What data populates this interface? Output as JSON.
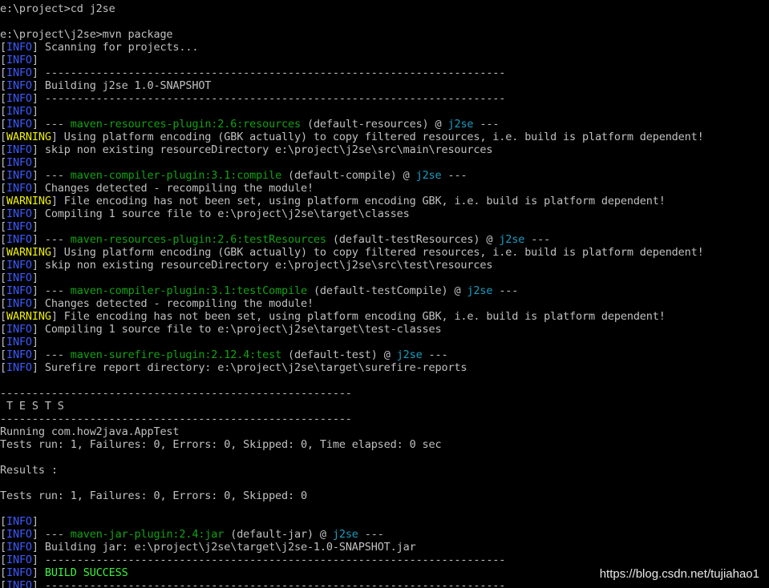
{
  "colors": {
    "background": "#000000",
    "text": "#c0c0c0",
    "info_tag": "#3b5bff",
    "plugin_name": "#12a312",
    "project_name": "#1a9ec2",
    "warning_tag": "#f0f000",
    "success": "#3cf23c"
  },
  "lines": [
    {
      "segs": [
        {
          "t": "e:\\project>cd j2se",
          "c": "default"
        }
      ]
    },
    {
      "segs": [
        {
          "t": "",
          "c": "default"
        }
      ]
    },
    {
      "segs": [
        {
          "t": "e:\\project\\j2se>mvn package",
          "c": "default"
        }
      ]
    },
    {
      "segs": [
        {
          "t": "[",
          "c": "default"
        },
        {
          "t": "INFO",
          "c": "blue"
        },
        {
          "t": "] Scanning for projects...",
          "c": "default"
        }
      ]
    },
    {
      "segs": [
        {
          "t": "[",
          "c": "default"
        },
        {
          "t": "INFO",
          "c": "blue"
        },
        {
          "t": "]",
          "c": "default"
        }
      ]
    },
    {
      "segs": [
        {
          "t": "[",
          "c": "default"
        },
        {
          "t": "INFO",
          "c": "blue"
        },
        {
          "t": "] ------------------------------------------------------------------------",
          "c": "default"
        }
      ]
    },
    {
      "segs": [
        {
          "t": "[",
          "c": "default"
        },
        {
          "t": "INFO",
          "c": "blue"
        },
        {
          "t": "] Building j2se 1.0-SNAPSHOT",
          "c": "default"
        }
      ]
    },
    {
      "segs": [
        {
          "t": "[",
          "c": "default"
        },
        {
          "t": "INFO",
          "c": "blue"
        },
        {
          "t": "] ------------------------------------------------------------------------",
          "c": "default"
        }
      ]
    },
    {
      "segs": [
        {
          "t": "[",
          "c": "default"
        },
        {
          "t": "INFO",
          "c": "blue"
        },
        {
          "t": "]",
          "c": "default"
        }
      ]
    },
    {
      "segs": [
        {
          "t": "[",
          "c": "default"
        },
        {
          "t": "INFO",
          "c": "blue"
        },
        {
          "t": "] --- ",
          "c": "default"
        },
        {
          "t": "maven-resources-plugin:2.6:resources",
          "c": "green"
        },
        {
          "t": " (default-resources) @ ",
          "c": "default"
        },
        {
          "t": "j2se",
          "c": "cyan"
        },
        {
          "t": " ---",
          "c": "default"
        }
      ]
    },
    {
      "segs": [
        {
          "t": "[",
          "c": "default"
        },
        {
          "t": "WARNING",
          "c": "yellow"
        },
        {
          "t": "] Using platform encoding (GBK actually) to copy filtered resources, i.e. build is platform dependent!",
          "c": "default"
        }
      ]
    },
    {
      "segs": [
        {
          "t": "[",
          "c": "default"
        },
        {
          "t": "INFO",
          "c": "blue"
        },
        {
          "t": "] skip non existing resourceDirectory e:\\project\\j2se\\src\\main\\resources",
          "c": "default"
        }
      ]
    },
    {
      "segs": [
        {
          "t": "[",
          "c": "default"
        },
        {
          "t": "INFO",
          "c": "blue"
        },
        {
          "t": "]",
          "c": "default"
        }
      ]
    },
    {
      "segs": [
        {
          "t": "[",
          "c": "default"
        },
        {
          "t": "INFO",
          "c": "blue"
        },
        {
          "t": "] --- ",
          "c": "default"
        },
        {
          "t": "maven-compiler-plugin:3.1:compile",
          "c": "green"
        },
        {
          "t": " (default-compile) @ ",
          "c": "default"
        },
        {
          "t": "j2se",
          "c": "cyan"
        },
        {
          "t": " ---",
          "c": "default"
        }
      ]
    },
    {
      "segs": [
        {
          "t": "[",
          "c": "default"
        },
        {
          "t": "INFO",
          "c": "blue"
        },
        {
          "t": "] Changes detected - recompiling the module!",
          "c": "default"
        }
      ]
    },
    {
      "segs": [
        {
          "t": "[",
          "c": "default"
        },
        {
          "t": "WARNING",
          "c": "yellow"
        },
        {
          "t": "] File encoding has not been set, using platform encoding GBK, i.e. build is platform dependent!",
          "c": "default"
        }
      ]
    },
    {
      "segs": [
        {
          "t": "[",
          "c": "default"
        },
        {
          "t": "INFO",
          "c": "blue"
        },
        {
          "t": "] Compiling 1 source file to e:\\project\\j2se\\target\\classes",
          "c": "default"
        }
      ]
    },
    {
      "segs": [
        {
          "t": "[",
          "c": "default"
        },
        {
          "t": "INFO",
          "c": "blue"
        },
        {
          "t": "]",
          "c": "default"
        }
      ]
    },
    {
      "segs": [
        {
          "t": "[",
          "c": "default"
        },
        {
          "t": "INFO",
          "c": "blue"
        },
        {
          "t": "] --- ",
          "c": "default"
        },
        {
          "t": "maven-resources-plugin:2.6:testResources",
          "c": "green"
        },
        {
          "t": " (default-testResources) @ ",
          "c": "default"
        },
        {
          "t": "j2se",
          "c": "cyan"
        },
        {
          "t": " ---",
          "c": "default"
        }
      ]
    },
    {
      "segs": [
        {
          "t": "[",
          "c": "default"
        },
        {
          "t": "WARNING",
          "c": "yellow"
        },
        {
          "t": "] Using platform encoding (GBK actually) to copy filtered resources, i.e. build is platform dependent!",
          "c": "default"
        }
      ]
    },
    {
      "segs": [
        {
          "t": "[",
          "c": "default"
        },
        {
          "t": "INFO",
          "c": "blue"
        },
        {
          "t": "] skip non existing resourceDirectory e:\\project\\j2se\\src\\test\\resources",
          "c": "default"
        }
      ]
    },
    {
      "segs": [
        {
          "t": "[",
          "c": "default"
        },
        {
          "t": "INFO",
          "c": "blue"
        },
        {
          "t": "]",
          "c": "default"
        }
      ]
    },
    {
      "segs": [
        {
          "t": "[",
          "c": "default"
        },
        {
          "t": "INFO",
          "c": "blue"
        },
        {
          "t": "] --- ",
          "c": "default"
        },
        {
          "t": "maven-compiler-plugin:3.1:testCompile",
          "c": "green"
        },
        {
          "t": " (default-testCompile) @ ",
          "c": "default"
        },
        {
          "t": "j2se",
          "c": "cyan"
        },
        {
          "t": " ---",
          "c": "default"
        }
      ]
    },
    {
      "segs": [
        {
          "t": "[",
          "c": "default"
        },
        {
          "t": "INFO",
          "c": "blue"
        },
        {
          "t": "] Changes detected - recompiling the module!",
          "c": "default"
        }
      ]
    },
    {
      "segs": [
        {
          "t": "[",
          "c": "default"
        },
        {
          "t": "WARNING",
          "c": "yellow"
        },
        {
          "t": "] File encoding has not been set, using platform encoding GBK, i.e. build is platform dependent!",
          "c": "default"
        }
      ]
    },
    {
      "segs": [
        {
          "t": "[",
          "c": "default"
        },
        {
          "t": "INFO",
          "c": "blue"
        },
        {
          "t": "] Compiling 1 source file to e:\\project\\j2se\\target\\test-classes",
          "c": "default"
        }
      ]
    },
    {
      "segs": [
        {
          "t": "[",
          "c": "default"
        },
        {
          "t": "INFO",
          "c": "blue"
        },
        {
          "t": "]",
          "c": "default"
        }
      ]
    },
    {
      "segs": [
        {
          "t": "[",
          "c": "default"
        },
        {
          "t": "INFO",
          "c": "blue"
        },
        {
          "t": "] --- ",
          "c": "default"
        },
        {
          "t": "maven-surefire-plugin:2.12.4:test",
          "c": "green"
        },
        {
          "t": " (default-test) @ ",
          "c": "default"
        },
        {
          "t": "j2se",
          "c": "cyan"
        },
        {
          "t": " ---",
          "c": "default"
        }
      ]
    },
    {
      "segs": [
        {
          "t": "[",
          "c": "default"
        },
        {
          "t": "INFO",
          "c": "blue"
        },
        {
          "t": "] Surefire report directory: e:\\project\\j2se\\target\\surefire-reports",
          "c": "default"
        }
      ]
    },
    {
      "segs": [
        {
          "t": "",
          "c": "default"
        }
      ]
    },
    {
      "segs": [
        {
          "t": "-------------------------------------------------------",
          "c": "default"
        }
      ]
    },
    {
      "segs": [
        {
          "t": " T E S T S",
          "c": "default"
        }
      ]
    },
    {
      "segs": [
        {
          "t": "-------------------------------------------------------",
          "c": "default"
        }
      ]
    },
    {
      "segs": [
        {
          "t": "Running com.how2java.AppTest",
          "c": "default"
        }
      ]
    },
    {
      "segs": [
        {
          "t": "Tests run: 1, Failures: 0, Errors: 0, Skipped: 0, Time elapsed: 0 sec",
          "c": "default"
        }
      ]
    },
    {
      "segs": [
        {
          "t": "",
          "c": "default"
        }
      ]
    },
    {
      "segs": [
        {
          "t": "Results :",
          "c": "default"
        }
      ]
    },
    {
      "segs": [
        {
          "t": "",
          "c": "default"
        }
      ]
    },
    {
      "segs": [
        {
          "t": "Tests run: 1, Failures: 0, Errors: 0, Skipped: 0",
          "c": "default"
        }
      ]
    },
    {
      "segs": [
        {
          "t": "",
          "c": "default"
        }
      ]
    },
    {
      "segs": [
        {
          "t": "[",
          "c": "default"
        },
        {
          "t": "INFO",
          "c": "blue"
        },
        {
          "t": "]",
          "c": "default"
        }
      ]
    },
    {
      "segs": [
        {
          "t": "[",
          "c": "default"
        },
        {
          "t": "INFO",
          "c": "blue"
        },
        {
          "t": "] --- ",
          "c": "default"
        },
        {
          "t": "maven-jar-plugin:2.4:jar",
          "c": "green"
        },
        {
          "t": " (default-jar) @ ",
          "c": "default"
        },
        {
          "t": "j2se",
          "c": "cyan"
        },
        {
          "t": " ---",
          "c": "default"
        }
      ]
    },
    {
      "segs": [
        {
          "t": "[",
          "c": "default"
        },
        {
          "t": "INFO",
          "c": "blue"
        },
        {
          "t": "] Building jar: e:\\project\\j2se\\target\\j2se-1.0-SNAPSHOT.jar",
          "c": "default"
        }
      ]
    },
    {
      "segs": [
        {
          "t": "[",
          "c": "default"
        },
        {
          "t": "INFO",
          "c": "blue"
        },
        {
          "t": "] ------------------------------------------------------------------------",
          "c": "default"
        }
      ]
    },
    {
      "segs": [
        {
          "t": "[",
          "c": "default"
        },
        {
          "t": "INFO",
          "c": "blue"
        },
        {
          "t": "] ",
          "c": "default"
        },
        {
          "t": "BUILD SUCCESS",
          "c": "bgreen"
        }
      ]
    },
    {
      "segs": [
        {
          "t": "[",
          "c": "default"
        },
        {
          "t": "INFO",
          "c": "blue"
        },
        {
          "t": "] ------------------------------------------------------------------------",
          "c": "default"
        }
      ]
    }
  ],
  "watermark": "https://blog.csdn.net/tujiahao1"
}
